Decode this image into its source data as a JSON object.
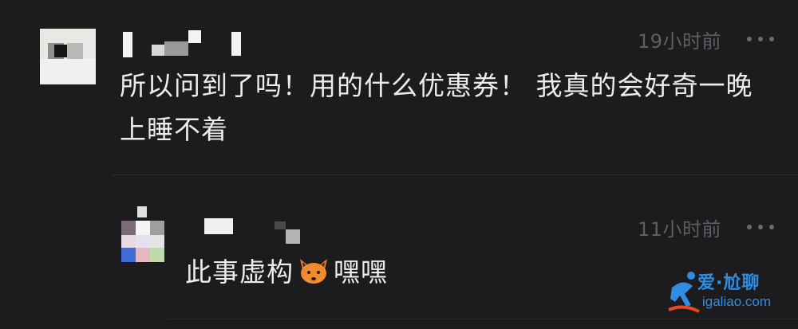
{
  "comment_main": {
    "time": "19小时前",
    "text": "所以问到了吗！用的什么优惠券！ 我真的会好奇一晚上睡不着"
  },
  "comment_reply": {
    "time": "11小时前",
    "text_before": "此事虚构",
    "emoji": "fox-face",
    "text_after": "嘿嘿"
  },
  "watermark": {
    "line1": "爱·尬聊",
    "line2": "igaliao.com"
  },
  "colors": {
    "background": "#1c1c1e",
    "text": "#ececec",
    "time": "#5f5f63",
    "watermark": "#2f8de4"
  }
}
